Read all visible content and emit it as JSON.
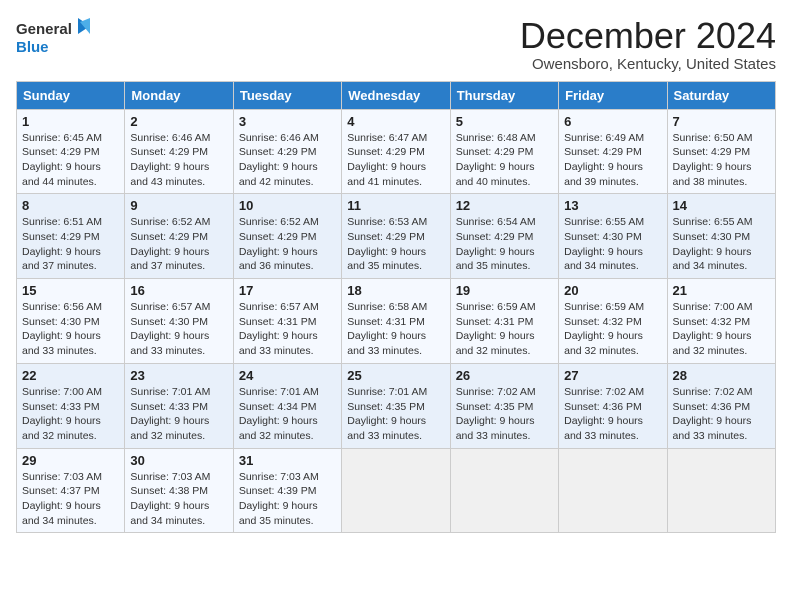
{
  "header": {
    "logo_general": "General",
    "logo_blue": "Blue",
    "title": "December 2024",
    "location": "Owensboro, Kentucky, United States"
  },
  "days_of_week": [
    "Sunday",
    "Monday",
    "Tuesday",
    "Wednesday",
    "Thursday",
    "Friday",
    "Saturday"
  ],
  "weeks": [
    [
      {
        "day": "1",
        "sunrise": "Sunrise: 6:45 AM",
        "sunset": "Sunset: 4:29 PM",
        "daylight": "Daylight: 9 hours and 44 minutes."
      },
      {
        "day": "2",
        "sunrise": "Sunrise: 6:46 AM",
        "sunset": "Sunset: 4:29 PM",
        "daylight": "Daylight: 9 hours and 43 minutes."
      },
      {
        "day": "3",
        "sunrise": "Sunrise: 6:46 AM",
        "sunset": "Sunset: 4:29 PM",
        "daylight": "Daylight: 9 hours and 42 minutes."
      },
      {
        "day": "4",
        "sunrise": "Sunrise: 6:47 AM",
        "sunset": "Sunset: 4:29 PM",
        "daylight": "Daylight: 9 hours and 41 minutes."
      },
      {
        "day": "5",
        "sunrise": "Sunrise: 6:48 AM",
        "sunset": "Sunset: 4:29 PM",
        "daylight": "Daylight: 9 hours and 40 minutes."
      },
      {
        "day": "6",
        "sunrise": "Sunrise: 6:49 AM",
        "sunset": "Sunset: 4:29 PM",
        "daylight": "Daylight: 9 hours and 39 minutes."
      },
      {
        "day": "7",
        "sunrise": "Sunrise: 6:50 AM",
        "sunset": "Sunset: 4:29 PM",
        "daylight": "Daylight: 9 hours and 38 minutes."
      }
    ],
    [
      {
        "day": "8",
        "sunrise": "Sunrise: 6:51 AM",
        "sunset": "Sunset: 4:29 PM",
        "daylight": "Daylight: 9 hours and 37 minutes."
      },
      {
        "day": "9",
        "sunrise": "Sunrise: 6:52 AM",
        "sunset": "Sunset: 4:29 PM",
        "daylight": "Daylight: 9 hours and 37 minutes."
      },
      {
        "day": "10",
        "sunrise": "Sunrise: 6:52 AM",
        "sunset": "Sunset: 4:29 PM",
        "daylight": "Daylight: 9 hours and 36 minutes."
      },
      {
        "day": "11",
        "sunrise": "Sunrise: 6:53 AM",
        "sunset": "Sunset: 4:29 PM",
        "daylight": "Daylight: 9 hours and 35 minutes."
      },
      {
        "day": "12",
        "sunrise": "Sunrise: 6:54 AM",
        "sunset": "Sunset: 4:29 PM",
        "daylight": "Daylight: 9 hours and 35 minutes."
      },
      {
        "day": "13",
        "sunrise": "Sunrise: 6:55 AM",
        "sunset": "Sunset: 4:30 PM",
        "daylight": "Daylight: 9 hours and 34 minutes."
      },
      {
        "day": "14",
        "sunrise": "Sunrise: 6:55 AM",
        "sunset": "Sunset: 4:30 PM",
        "daylight": "Daylight: 9 hours and 34 minutes."
      }
    ],
    [
      {
        "day": "15",
        "sunrise": "Sunrise: 6:56 AM",
        "sunset": "Sunset: 4:30 PM",
        "daylight": "Daylight: 9 hours and 33 minutes."
      },
      {
        "day": "16",
        "sunrise": "Sunrise: 6:57 AM",
        "sunset": "Sunset: 4:30 PM",
        "daylight": "Daylight: 9 hours and 33 minutes."
      },
      {
        "day": "17",
        "sunrise": "Sunrise: 6:57 AM",
        "sunset": "Sunset: 4:31 PM",
        "daylight": "Daylight: 9 hours and 33 minutes."
      },
      {
        "day": "18",
        "sunrise": "Sunrise: 6:58 AM",
        "sunset": "Sunset: 4:31 PM",
        "daylight": "Daylight: 9 hours and 33 minutes."
      },
      {
        "day": "19",
        "sunrise": "Sunrise: 6:59 AM",
        "sunset": "Sunset: 4:31 PM",
        "daylight": "Daylight: 9 hours and 32 minutes."
      },
      {
        "day": "20",
        "sunrise": "Sunrise: 6:59 AM",
        "sunset": "Sunset: 4:32 PM",
        "daylight": "Daylight: 9 hours and 32 minutes."
      },
      {
        "day": "21",
        "sunrise": "Sunrise: 7:00 AM",
        "sunset": "Sunset: 4:32 PM",
        "daylight": "Daylight: 9 hours and 32 minutes."
      }
    ],
    [
      {
        "day": "22",
        "sunrise": "Sunrise: 7:00 AM",
        "sunset": "Sunset: 4:33 PM",
        "daylight": "Daylight: 9 hours and 32 minutes."
      },
      {
        "day": "23",
        "sunrise": "Sunrise: 7:01 AM",
        "sunset": "Sunset: 4:33 PM",
        "daylight": "Daylight: 9 hours and 32 minutes."
      },
      {
        "day": "24",
        "sunrise": "Sunrise: 7:01 AM",
        "sunset": "Sunset: 4:34 PM",
        "daylight": "Daylight: 9 hours and 32 minutes."
      },
      {
        "day": "25",
        "sunrise": "Sunrise: 7:01 AM",
        "sunset": "Sunset: 4:35 PM",
        "daylight": "Daylight: 9 hours and 33 minutes."
      },
      {
        "day": "26",
        "sunrise": "Sunrise: 7:02 AM",
        "sunset": "Sunset: 4:35 PM",
        "daylight": "Daylight: 9 hours and 33 minutes."
      },
      {
        "day": "27",
        "sunrise": "Sunrise: 7:02 AM",
        "sunset": "Sunset: 4:36 PM",
        "daylight": "Daylight: 9 hours and 33 minutes."
      },
      {
        "day": "28",
        "sunrise": "Sunrise: 7:02 AM",
        "sunset": "Sunset: 4:36 PM",
        "daylight": "Daylight: 9 hours and 33 minutes."
      }
    ],
    [
      {
        "day": "29",
        "sunrise": "Sunrise: 7:03 AM",
        "sunset": "Sunset: 4:37 PM",
        "daylight": "Daylight: 9 hours and 34 minutes."
      },
      {
        "day": "30",
        "sunrise": "Sunrise: 7:03 AM",
        "sunset": "Sunset: 4:38 PM",
        "daylight": "Daylight: 9 hours and 34 minutes."
      },
      {
        "day": "31",
        "sunrise": "Sunrise: 7:03 AM",
        "sunset": "Sunset: 4:39 PM",
        "daylight": "Daylight: 9 hours and 35 minutes."
      },
      null,
      null,
      null,
      null
    ]
  ]
}
